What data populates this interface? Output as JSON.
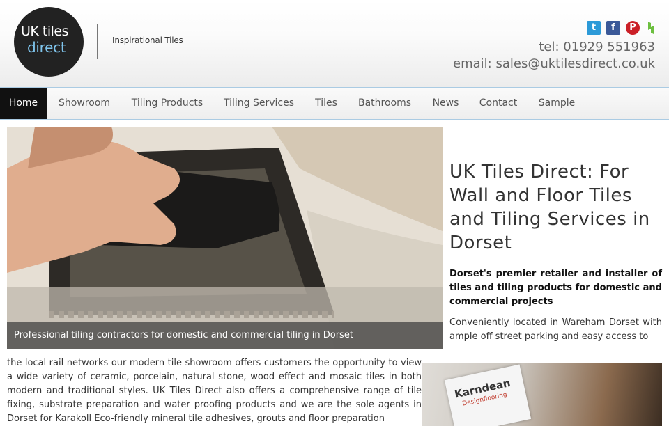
{
  "logo": {
    "line1": "UK tiles",
    "line2": "direct"
  },
  "tagline": "Inspirational Tiles",
  "social": {
    "twitter_icon": "twitter-icon",
    "facebook_icon": "facebook-icon",
    "pinterest_icon": "pinterest-icon",
    "houzz_icon": "houzz-icon"
  },
  "contact": {
    "tel": "tel: 01929 551963",
    "email": "email: sales@uktilesdirect.co.uk"
  },
  "nav": {
    "items": [
      "Home",
      "Showroom",
      "Tiling Products",
      "Tiling Services",
      "Tiles",
      "Bathrooms",
      "News",
      "Contact",
      "Sample"
    ],
    "active": "Home"
  },
  "hero": {
    "caption": "Professional tiling contractors for domestic and commercial tiling in Dorset"
  },
  "main": {
    "title": "UK Tiles Direct: For Wall and Floor Tiles and Tiling Services in Dorset",
    "intro_bold": "Dorset's premier retailer and installer of tiles and tiling products for domestic and commercial projects",
    "intro": "Conveniently located in Wareham Dorset with ample off street parking and easy access to",
    "body": "the local rail networks our modern tile showroom offers customers the opportunity to view a wide variety of ceramic, porcelain, natural stone, wood effect and mosaic tiles in both modern and traditional styles.  UK Tiles Direct also offers a comprehensive range of tile fixing, substrate preparation and water proofing products and we are the sole agents in Dorset for Karakoll Eco-friendly mineral tile adhesives, grouts and floor preparation"
  },
  "showroom_image": {
    "brand": "Karndean",
    "sub": "Designflooring"
  }
}
